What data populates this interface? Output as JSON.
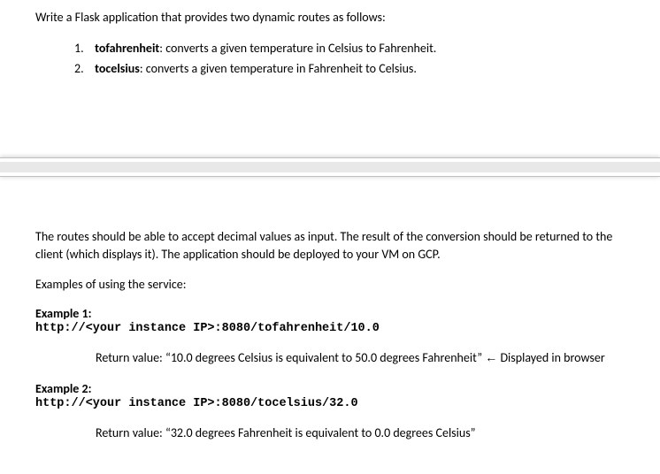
{
  "intro": "Write a Flask application that provides two dynamic routes as follows:",
  "list": {
    "items": [
      {
        "num": "1.",
        "name": "tofahrenheit",
        "desc": ": converts a given temperature in Celsius to Fahrenheit."
      },
      {
        "num": "2.",
        "name": "tocelsius",
        "desc": ": converts a given temperature in Fahrenheit to Celsius."
      }
    ]
  },
  "para1": "The routes should be able to accept decimal values as input.  The result of the conversion should be returned to the client (which displays it).  The application should be deployed to your VM on GCP.",
  "para2": "Examples of using the service:",
  "example1": {
    "label": "Example 1:",
    "url": "http://<your instance IP>:8080/tofahrenheit/10.0",
    "return_prefix": "Return value: “10.0 degrees Celsius is equivalent to 50.0 degrees Fahrenheit” ",
    "arrow": "←",
    "return_suffix": " Displayed in browser"
  },
  "example2": {
    "label": "Example 2:",
    "url": "http://<your instance IP>:8080/tocelsius/32.0",
    "return": "Return value: “32.0 degrees Fahrenheit is equivalent to 0.0 degrees Celsius”"
  }
}
